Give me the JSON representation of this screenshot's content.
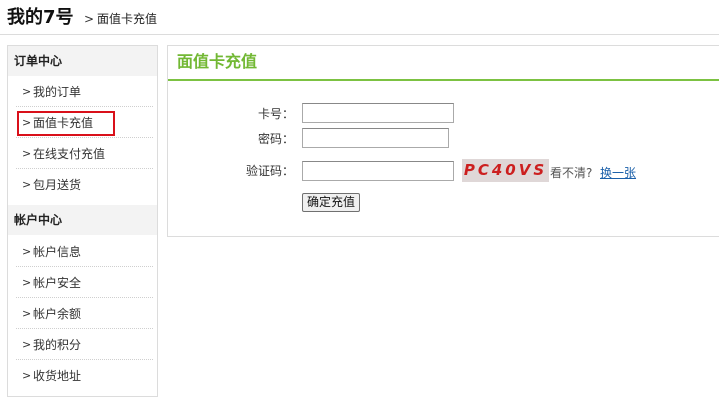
{
  "header": {
    "site_title": "我的7号",
    "breadcrumb_arrow": ">",
    "breadcrumb_current": "面值卡充值"
  },
  "sidebar": {
    "sections": [
      {
        "title": "订单中心",
        "items": [
          {
            "label": "我的订单"
          },
          {
            "label": "面值卡充值",
            "highlighted": true
          },
          {
            "label": "在线支付充值"
          },
          {
            "label": "包月送货"
          }
        ]
      },
      {
        "title": "帐户中心",
        "items": [
          {
            "label": "帐户信息"
          },
          {
            "label": "帐户安全"
          },
          {
            "label": "帐户余额"
          },
          {
            "label": "我的积分"
          },
          {
            "label": "收货地址"
          }
        ]
      }
    ],
    "arrow": ">"
  },
  "panel": {
    "title": "面值卡充值",
    "form": {
      "card_number_label": "卡号：",
      "card_number_value": "",
      "password_label": "密码：",
      "password_value": "",
      "captcha_label": "验证码：",
      "captcha_value": "",
      "captcha_text": "PC40VS",
      "unclear_text": "看不清?",
      "change_link": "换一张",
      "submit_label": "确定充值"
    }
  },
  "colors": {
    "accent_green": "#72b834",
    "highlight_red": "#d9101a",
    "captcha_red": "#cc1f1f",
    "link_blue": "#1a5fa9"
  }
}
